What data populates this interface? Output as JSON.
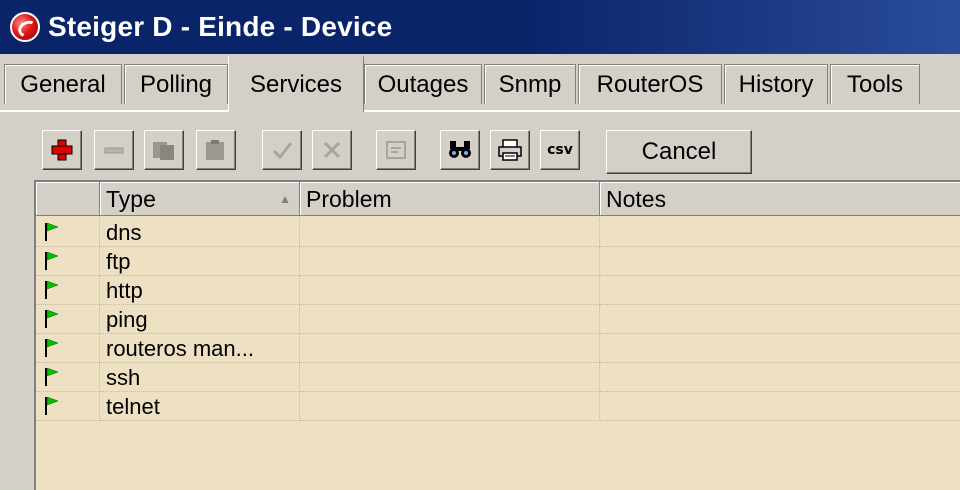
{
  "window": {
    "title": "Steiger D - Einde - Device"
  },
  "tabs": [
    {
      "label": "General"
    },
    {
      "label": "Polling"
    },
    {
      "label": "Services",
      "active": true
    },
    {
      "label": "Outages"
    },
    {
      "label": "Snmp"
    },
    {
      "label": "RouterOS"
    },
    {
      "label": "History"
    },
    {
      "label": "Tools"
    }
  ],
  "toolbar": {
    "cancel_label": "Cancel",
    "csv_label": "csv",
    "icons": [
      "add-icon",
      "remove-icon",
      "copy-icon",
      "paste-icon",
      "enable-icon",
      "disable-icon",
      "comment-icon",
      "find-icon",
      "print-icon",
      "csv-export-icon"
    ]
  },
  "grid": {
    "columns": [
      "",
      "Type",
      "Problem",
      "Notes"
    ],
    "rows": [
      {
        "type": "dns",
        "problem": "",
        "notes": ""
      },
      {
        "type": "ftp",
        "problem": "",
        "notes": ""
      },
      {
        "type": "http",
        "problem": "",
        "notes": ""
      },
      {
        "type": "ping",
        "problem": "",
        "notes": ""
      },
      {
        "type": "routeros man...",
        "problem": "",
        "notes": ""
      },
      {
        "type": "ssh",
        "problem": "",
        "notes": ""
      },
      {
        "type": "telnet",
        "problem": "",
        "notes": ""
      }
    ]
  },
  "colors": {
    "titlebar": "#0a246a",
    "grid_background": "#ede0c3",
    "flag_green": "#00c000",
    "add_red": "#e00000"
  }
}
